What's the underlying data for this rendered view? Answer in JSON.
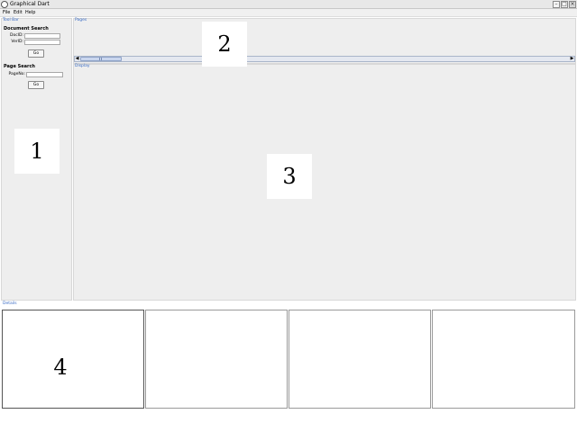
{
  "window": {
    "title": "Graphical Dart"
  },
  "menu": [
    "File",
    "Edit",
    "Help"
  ],
  "toolbar": {
    "title": "Tool Bar",
    "document_search": {
      "title": "Document Search",
      "docid_label": "DocID:",
      "docid_value": "",
      "verid_label": "VerID:",
      "verid_value": "",
      "go_label": "Go"
    },
    "page_search": {
      "title": "Page Search",
      "pageno_label": "PageNo:",
      "pageno_value": "",
      "go_label": "Go"
    }
  },
  "pages": {
    "title": "Pages"
  },
  "display": {
    "title": "Display"
  },
  "details": {
    "title": "Details"
  },
  "markers": [
    "1",
    "2",
    "3",
    "4"
  ]
}
